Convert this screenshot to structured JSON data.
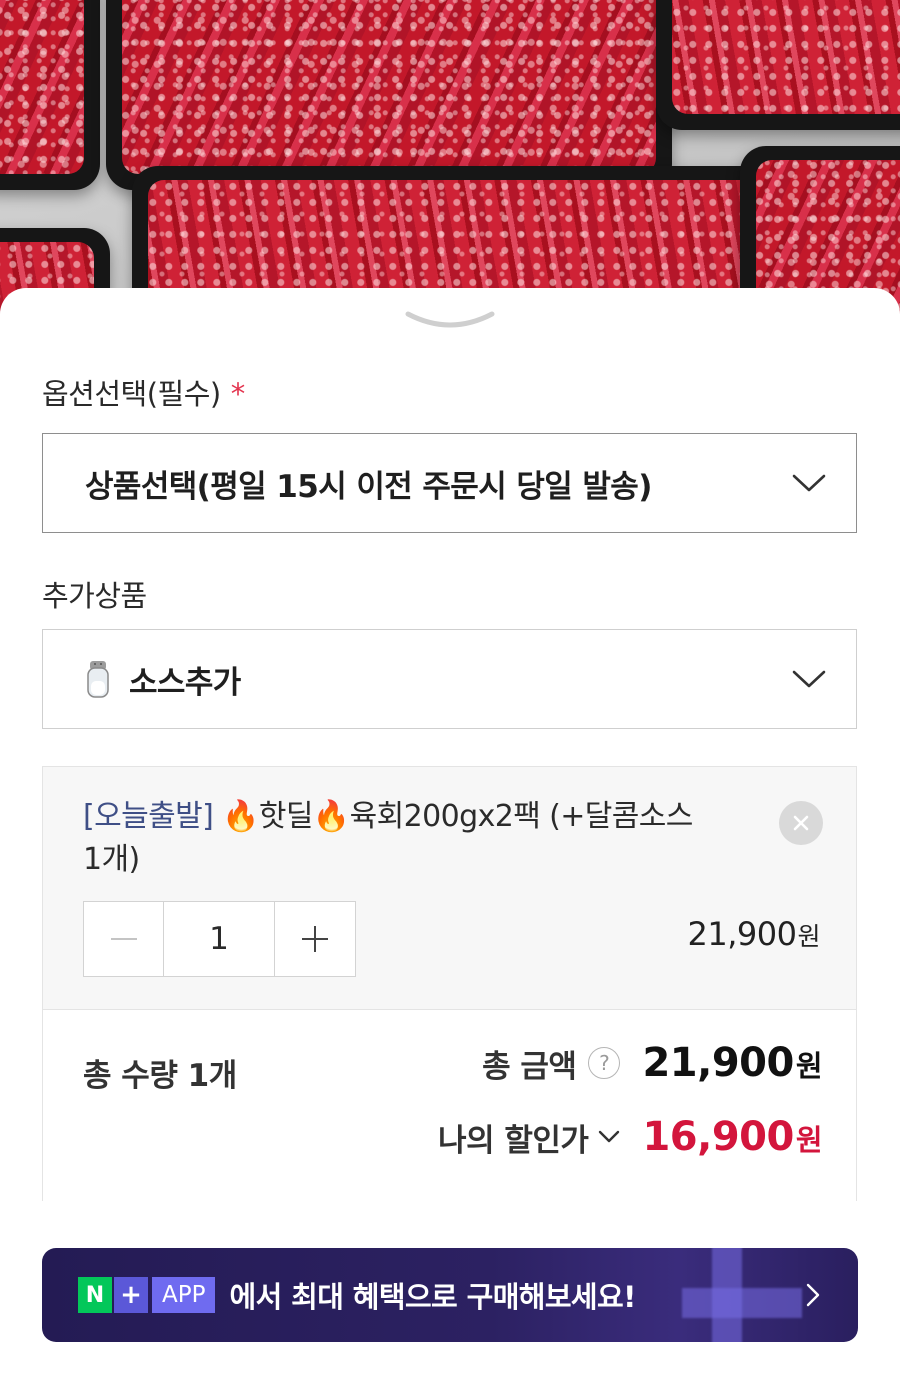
{
  "hero": {
    "image_alt": "marbled beef trays"
  },
  "options": {
    "title": "옵션선택(필수)",
    "required_mark": "*",
    "select_text": "상품선택(평일 15시 이전 주문시 당일 발송)",
    "select_icon": "chevron-down-icon"
  },
  "addons": {
    "title": "추가상품",
    "select_icon_emoji": "salt-shaker-icon",
    "select_text": "소스추가"
  },
  "selected_item": {
    "tag": "[오늘출발]",
    "name_part1": "🔥핫딜🔥육회200gx2팩 (+달콤소스",
    "name_part2": "1개)",
    "quantity": "1",
    "price_number": "21,900",
    "price_unit": "원"
  },
  "summary": {
    "total_qty_label": "총 수량 1개",
    "total_label": "총 금액",
    "help_symbol": "?",
    "total_number": "21,900",
    "total_unit": "원",
    "discount_label": "나의 할인가",
    "discount_number": "16,900",
    "discount_unit": "원"
  },
  "banner": {
    "badge_n": "N",
    "badge_plus": "+",
    "badge_app": "APP",
    "text": "에서 최대 혜택으로 구매해보세요!"
  },
  "colors": {
    "accent_red": "#d3153c",
    "required_red": "#e3344f",
    "naver_green": "#03c75a",
    "banner_bg": "#241b54"
  }
}
